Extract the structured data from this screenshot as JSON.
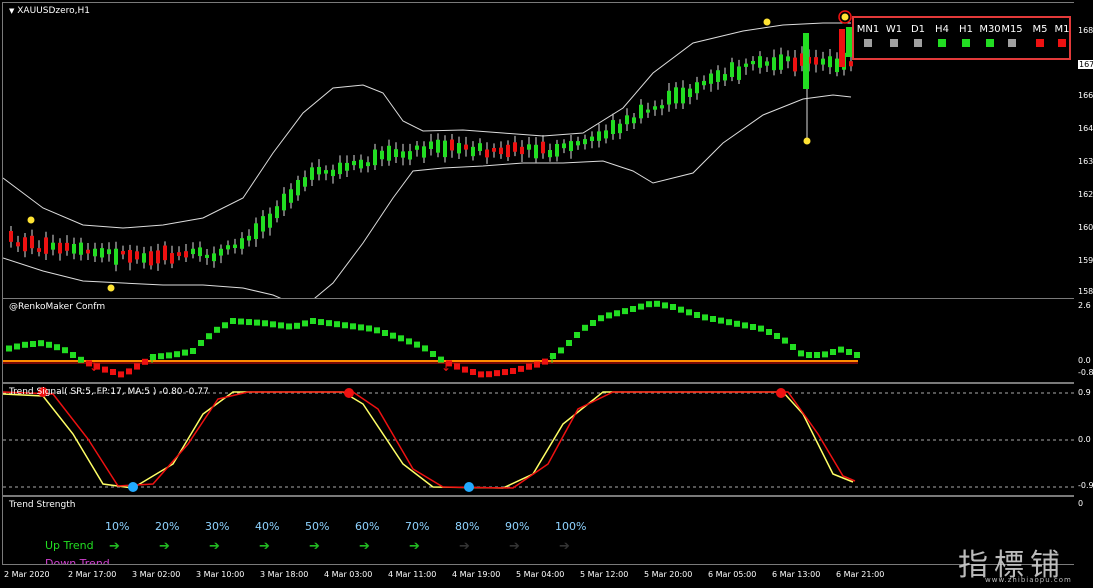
{
  "main_chart": {
    "title": "XAUUSDzero,H1",
    "price_labels": [
      "168",
      "167",
      "166",
      "164",
      "163",
      "162",
      "160",
      "159",
      "158"
    ],
    "timeframes": [
      {
        "label": "MN1",
        "color": "#a0a0a0"
      },
      {
        "label": "W1",
        "color": "#a0a0a0"
      },
      {
        "label": "D1",
        "color": "#a0a0a0"
      },
      {
        "label": "H4",
        "color": "#22dd22"
      },
      {
        "label": "H1",
        "color": "#22dd22"
      },
      {
        "label": "M30",
        "color": "#22dd22"
      },
      {
        "label": "M15",
        "color": "#a0a0a0"
      },
      {
        "label": "M5",
        "color": "#ee1111"
      },
      {
        "label": "M1",
        "color": "#ee1111"
      }
    ]
  },
  "renko_pane": {
    "title": "@RenkoMaker Confm",
    "axis_labels": [
      "2.6",
      "0.0",
      "-0.8"
    ]
  },
  "trend_signal_pane": {
    "title": "Trend Signal( SR:5, FP:17, MA:5 ) -0.80 -0.77",
    "axis_labels": [
      "0.9",
      "0.0",
      "-0.9"
    ]
  },
  "trend_strength_pane": {
    "title": "Trend Strength",
    "axis_labels": [
      "0"
    ],
    "percentages": [
      "10%",
      "20%",
      "30%",
      "40%",
      "50%",
      "60%",
      "70%",
      "80%",
      "90%",
      "100%"
    ],
    "up_label": "Up Trend",
    "down_label": "Down Trend",
    "up_active_count": 7
  },
  "time_labels": [
    "2 Mar 2020",
    "2 Mar 17:00",
    "3 Mar 02:00",
    "3 Mar 10:00",
    "3 Mar 18:00",
    "4 Mar 03:00",
    "4 Mar 11:00",
    "4 Mar 19:00",
    "5 Mar 04:00",
    "5 Mar 12:00",
    "5 Mar 20:00",
    "6 Mar 05:00",
    "6 Mar 13:00",
    "6 Mar 21:00"
  ],
  "watermark": {
    "text": "指標铺",
    "url": "www.zhibiaopu.com"
  }
}
